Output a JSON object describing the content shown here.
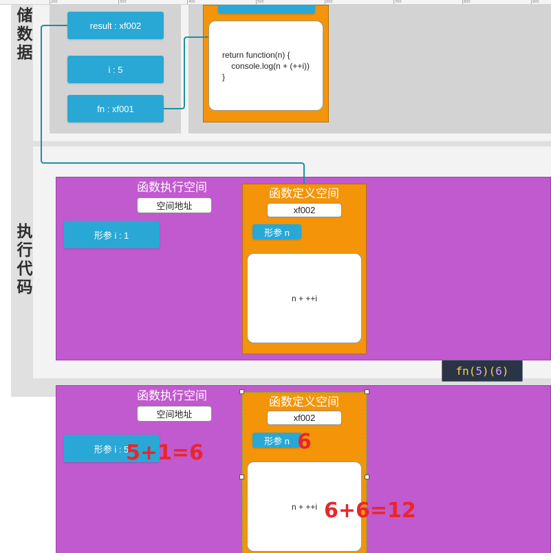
{
  "ruler": {
    "ticks": [
      "200",
      "300",
      "400",
      "500",
      "600",
      "700",
      "800",
      "900"
    ]
  },
  "storage": {
    "title_chars": [
      "储",
      "数",
      "据"
    ],
    "vars": {
      "result": "result : xf002",
      "i": "i : 5",
      "fn": "fn : xf001"
    },
    "func_code": "return function(n) {\n    console.log(n + (++i))\n}"
  },
  "execution": {
    "title_chars": [
      "执",
      "行",
      "代",
      "码"
    ],
    "block1": {
      "exec_space_title": "函数执行空间",
      "address_label": "空间地址",
      "param_i": "形参 i : 1",
      "def_space_title": "函数定义空间",
      "def_address": "xf002",
      "param_n": "形参 n",
      "code": "n + ++i"
    },
    "call_label_prefix": "fn(",
    "call_arg1": "5",
    "call_mid": ")(",
    "call_arg2": "6",
    "call_suffix": ")"
  },
  "block2": {
    "exec_space_title": "函数执行空间",
    "address_label": "空间地址",
    "param_i": "形参 i : 5",
    "def_space_title": "函数定义空间",
    "def_address": "xf002",
    "param_n": "形参 n",
    "code": "n + ++i",
    "annotation_i": "5+1=6",
    "annotation_n": "6",
    "annotation_result": "6+6=12"
  },
  "colors": {
    "blue": "#29a8d6",
    "orange": "#f39409",
    "magenta": "#c159cf",
    "connector": "#1c8fa0",
    "annotation": "#e8262b"
  }
}
